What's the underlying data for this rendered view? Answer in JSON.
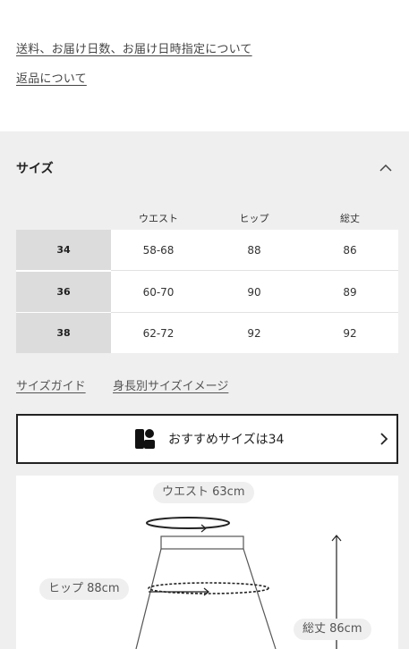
{
  "links": {
    "shipping": "送料、お届け日数、お届け日時指定について",
    "returns": "返品について"
  },
  "size_panel": {
    "title": "サイズ",
    "columns": [
      "ウエスト",
      "ヒップ",
      "総丈"
    ],
    "rows": [
      {
        "size": "34",
        "values": [
          "58-68",
          "88",
          "86"
        ]
      },
      {
        "size": "36",
        "values": [
          "60-70",
          "90",
          "89"
        ]
      },
      {
        "size": "38",
        "values": [
          "62-72",
          "92",
          "92"
        ]
      }
    ],
    "guide_links": [
      "サイズガイド",
      "身長別サイズイメージ"
    ],
    "recommend": "おすすめサイズは34"
  },
  "diagram": {
    "waist": "ウエスト 63cm",
    "hip": "ヒップ 88cm",
    "length": "総丈 86cm"
  }
}
